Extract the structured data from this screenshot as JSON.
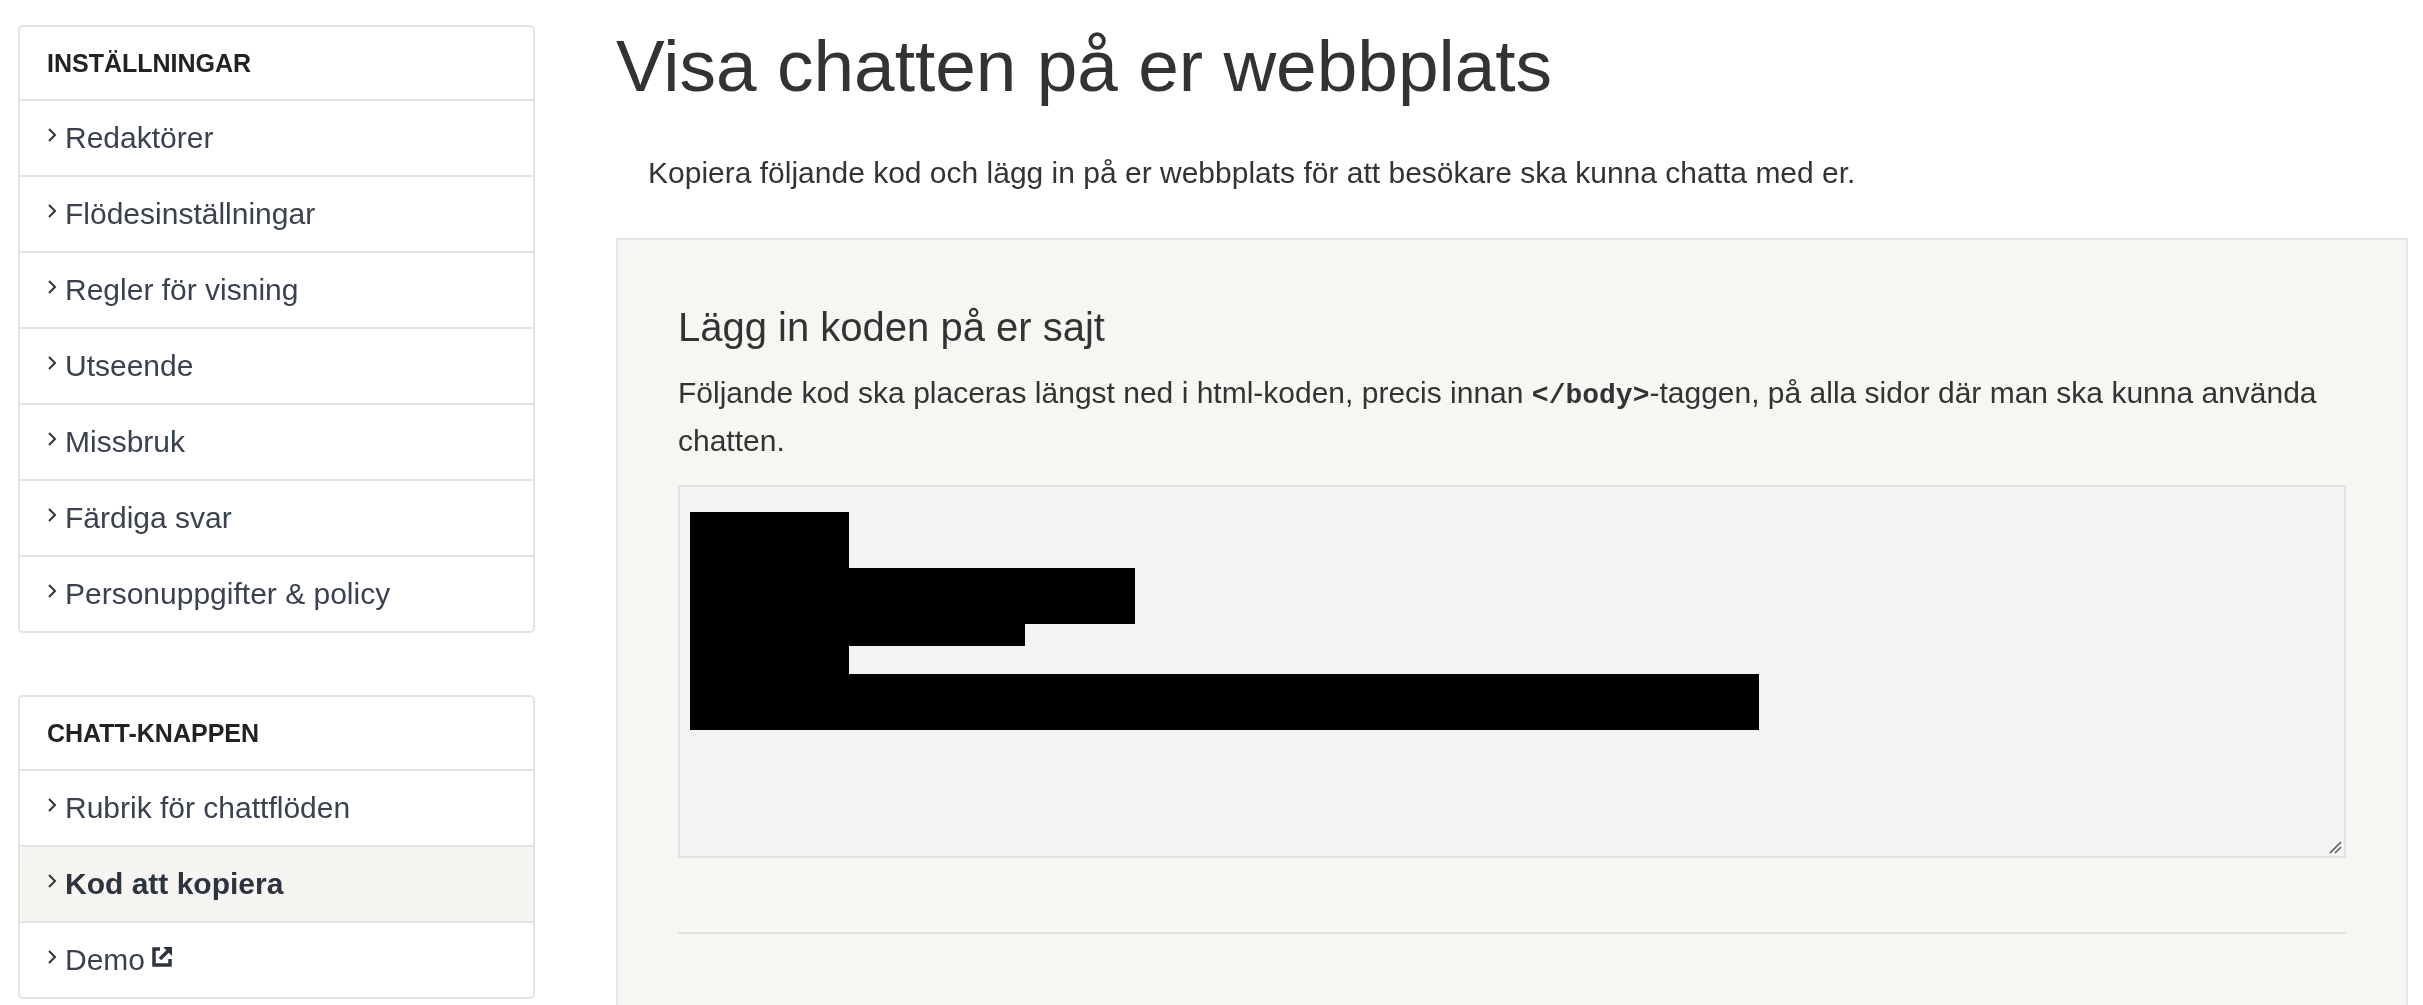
{
  "sidebar": {
    "sections": [
      {
        "title": "INSTÄLLNINGAR",
        "items": [
          {
            "label": "Redaktörer",
            "selected": false,
            "external": false
          },
          {
            "label": "Flödesinställningar",
            "selected": false,
            "external": false
          },
          {
            "label": "Regler för visning",
            "selected": false,
            "external": false
          },
          {
            "label": "Utseende",
            "selected": false,
            "external": false
          },
          {
            "label": "Missbruk",
            "selected": false,
            "external": false
          },
          {
            "label": "Färdiga svar",
            "selected": false,
            "external": false
          },
          {
            "label": "Personuppgifter & policy",
            "selected": false,
            "external": false
          }
        ]
      },
      {
        "title": "CHATT-KNAPPEN",
        "items": [
          {
            "label": "Rubrik för chattflöden",
            "selected": false,
            "external": false
          },
          {
            "label": "Kod att kopiera",
            "selected": true,
            "external": false
          },
          {
            "label": "Demo",
            "selected": false,
            "external": true
          }
        ]
      }
    ]
  },
  "main": {
    "title": "Visa chatten på er webbplats",
    "intro": "Kopiera följande kod och lägg in på er webbplats för att besökare ska kunna chatta med er.",
    "panel": {
      "heading": "Lägg in koden på er sajt",
      "description": {
        "before": "Följande kod ska placeras längst ned i html-koden, precis innan ",
        "code": "</body>",
        "after": "-taggen, på alla sidor där man ska kunna använda chatten."
      },
      "code_box": {
        "redacted": true
      }
    }
  }
}
